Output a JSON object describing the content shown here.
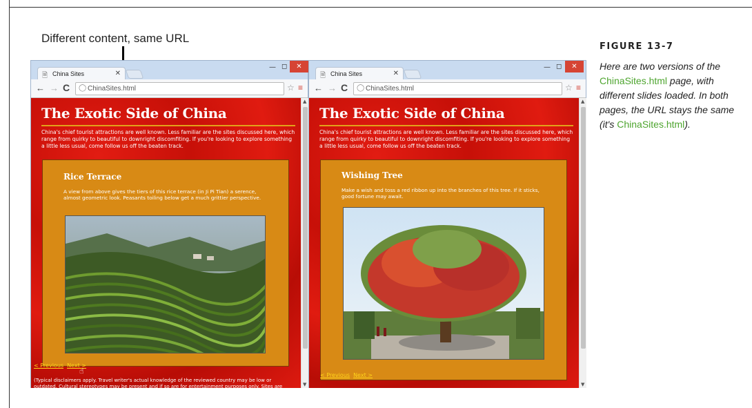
{
  "callout": {
    "text": "Different content, same URL"
  },
  "figure": {
    "label": "FIGURE 13-7",
    "caption_parts": [
      "Here are two versions of the ",
      "ChinaSites.html",
      " page, with different slides loaded. In both pages, the URL stays the same (it's ",
      "ChinaSites.html",
      ")."
    ]
  },
  "colors": {
    "page_red": "#d8180e",
    "slide_orange": "#d88a15",
    "title_rule": "#e2a21a",
    "pager_link": "#ffd51a",
    "caption_link": "#4ea52f",
    "close_button": "#d64434"
  },
  "browsers": [
    {
      "tab_title": "China Sites",
      "url": "ChinaSites.html",
      "page": {
        "title": "The Exotic Side of China",
        "intro": "China's chief tourist attractions are well known. Less familiar are the sites discussed here, which range from quirky to beautiful to downright discomfiting. If you're looking to explore something a little less usual, come follow us off the beaten track.",
        "slide_title": "Rice Terrace",
        "slide_desc": "A view from above gives the tiers of this rice terrace (in Ji Pi Tian) a serence, almost geometric look. Peasants toiling below get a much grittier perspective.",
        "prev_label": "< Previous",
        "next_label": "Next >",
        "disclaimer": "(Typical disclaimers apply. Travel writer's actual knowledge of the reviewed country may be low or outdated. Cultural stereotypes may be present and if so are for entertainment purposes only. Sites are"
      }
    },
    {
      "tab_title": "China Sites",
      "url": "ChinaSites.html",
      "page": {
        "title": "The Exotic Side of China",
        "intro": "China's chief tourist attractions are well known. Less familiar are the sites discussed here, which range from quirky to beautiful to downright discomfiting. If you're looking to explore something a little less usual, come follow us off the beaten track.",
        "slide_title": "Wishing Tree",
        "slide_desc": "Make a wish and toss a red ribbon up into the branches of this tree. If it sticks, good fortune may await.",
        "prev_label": "< Previous",
        "next_label": "Next >"
      }
    }
  ],
  "icons": [
    "page-icon",
    "close-icon",
    "back-icon",
    "forward-icon",
    "reload-icon",
    "site-info-icon",
    "star-icon",
    "menu-icon",
    "hand-cursor-icon"
  ]
}
